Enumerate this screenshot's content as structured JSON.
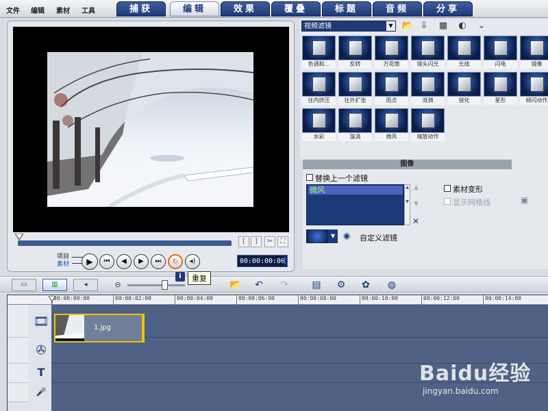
{
  "menu": {
    "items": [
      "文件",
      "编辑",
      "素材",
      "工具"
    ]
  },
  "tabs": [
    {
      "label": "捕获",
      "active": false
    },
    {
      "label": "编辑",
      "active": true
    },
    {
      "label": "效果",
      "active": false
    },
    {
      "label": "覆叠",
      "active": false
    },
    {
      "label": "标题",
      "active": false
    },
    {
      "label": "音频",
      "active": false
    },
    {
      "label": "分享",
      "active": false
    }
  ],
  "preview": {
    "mode_project": "项目",
    "mode_clip": "素材",
    "timecode": "00:00:00:00",
    "mark_in": "[",
    "mark_out": "]"
  },
  "library": {
    "category": "视频滤镜",
    "filters": [
      {
        "label": "色调和..."
      },
      {
        "label": "反转"
      },
      {
        "label": "万花筒"
      },
      {
        "label": "镜头闪光"
      },
      {
        "label": "光线"
      },
      {
        "label": "闪电"
      },
      {
        "label": "镜像"
      },
      {
        "label": "往内挤压"
      },
      {
        "label": "往外扩张"
      },
      {
        "label": "雨点"
      },
      {
        "label": "涟漪"
      },
      {
        "label": "锐化"
      },
      {
        "label": "星形"
      },
      {
        "label": "频闪动作"
      },
      {
        "label": "水彩"
      },
      {
        "label": "漩涡"
      },
      {
        "label": "微风"
      },
      {
        "label": "缩放动作"
      }
    ]
  },
  "options": {
    "tab_label": "图像",
    "replace_last_filter": "替换上一个滤镜",
    "applied_filter": "微风",
    "clip_transform": "素材变形",
    "show_grid": "显示网格线",
    "custom_filter": "自定义滤镜"
  },
  "toolbar": {
    "tooltip": "重复"
  },
  "timeline": {
    "ruler": [
      "00:00:00:00",
      "00:00:02:00",
      "00:00:04:00",
      "00:00:06:00",
      "00:00:08:00",
      "00:00:10:00",
      "00:00:12:00",
      "00:00:14:00"
    ],
    "clip_name": "1.jpg"
  },
  "watermark": {
    "main": "Baidu经验",
    "sub": "jingyan.baidu.com"
  },
  "colors": {
    "accent_navy": "#1d3a78",
    "clip_border": "#f2c200",
    "applied_text": "#9cff7a"
  }
}
